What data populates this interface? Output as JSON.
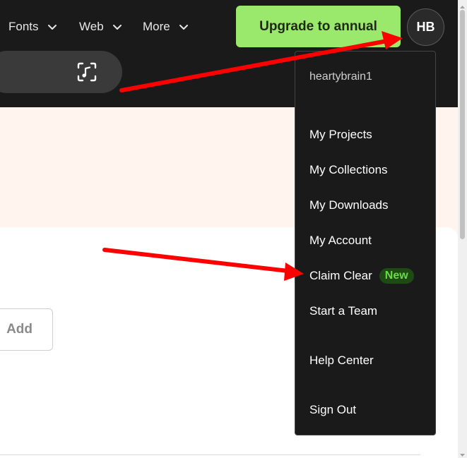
{
  "nav": {
    "items": [
      {
        "label": "Fonts"
      },
      {
        "label": "Web"
      },
      {
        "label": "More"
      }
    ]
  },
  "header": {
    "upgrade_label": "Upgrade to annual",
    "avatar_initials": "HB"
  },
  "search": {
    "audio_icon": "audio-search-icon"
  },
  "page": {
    "add_label": "Add"
  },
  "user_menu": {
    "username": "heartybrain1",
    "items": [
      {
        "label": "My Projects"
      },
      {
        "label": "My Collections"
      },
      {
        "label": "My Downloads"
      },
      {
        "label": "My Account"
      },
      {
        "label": "Claim Clear",
        "badge": "New"
      },
      {
        "label": "Start a Team"
      },
      {
        "label": "Help Center"
      },
      {
        "label": "Sign Out"
      }
    ]
  },
  "colors": {
    "topbar_bg": "#1a1a1a",
    "upgrade_bg": "#9ae86c",
    "banner_bg": "#fff5ee",
    "badge_bg": "#1e4a14",
    "badge_text": "#6cd84a",
    "annotation_arrow": "#ff0000"
  }
}
